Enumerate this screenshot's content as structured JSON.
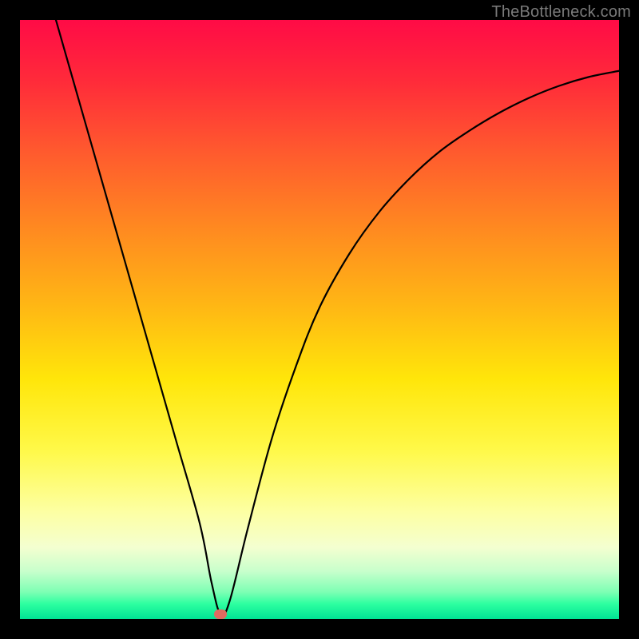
{
  "watermark": "TheBottleneck.com",
  "colors": {
    "frame": "#000000",
    "marker": "#e06a60",
    "curve": "#000000"
  },
  "chart_data": {
    "type": "line",
    "title": "",
    "xlabel": "",
    "ylabel": "",
    "xlim": [
      0,
      100
    ],
    "ylim": [
      0,
      100
    ],
    "grid": false,
    "series": [
      {
        "name": "bottleneck-curve",
        "x": [
          6,
          10,
          14,
          18,
          22,
          26,
          30,
          32,
          33.5,
          35,
          38,
          42,
          46,
          50,
          55,
          60,
          65,
          70,
          75,
          80,
          85,
          90,
          95,
          100
        ],
        "y": [
          100,
          86,
          72,
          58,
          44,
          30,
          16,
          6,
          0.8,
          3,
          15,
          30,
          42,
          52,
          61,
          68,
          73.5,
          78,
          81.5,
          84.5,
          87,
          89,
          90.5,
          91.5
        ]
      }
    ],
    "marker": {
      "x": 33.5,
      "y": 0.8
    },
    "gradient_stops": [
      {
        "pos": 0,
        "color": "#ff0b46"
      },
      {
        "pos": 10,
        "color": "#ff2a3a"
      },
      {
        "pos": 22,
        "color": "#ff5a2e"
      },
      {
        "pos": 35,
        "color": "#ff8a20"
      },
      {
        "pos": 48,
        "color": "#ffb814"
      },
      {
        "pos": 60,
        "color": "#ffe60a"
      },
      {
        "pos": 72,
        "color": "#fff94a"
      },
      {
        "pos": 82,
        "color": "#fdffa2"
      },
      {
        "pos": 88,
        "color": "#f4ffd0"
      },
      {
        "pos": 92,
        "color": "#c8ffcc"
      },
      {
        "pos": 95.5,
        "color": "#7dffb4"
      },
      {
        "pos": 97.5,
        "color": "#2cffa0"
      },
      {
        "pos": 100,
        "color": "#00e394"
      }
    ]
  }
}
